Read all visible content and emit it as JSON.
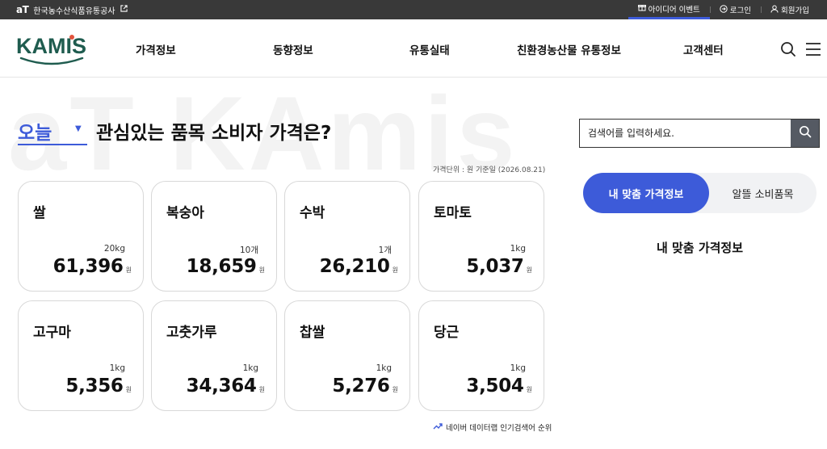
{
  "topbar": {
    "org_logo": "aT",
    "org_name": "한국농수산식품유통공사",
    "links": [
      {
        "label": "아이디어 이벤트",
        "icon": "gift-icon"
      },
      {
        "label": "로그인",
        "icon": "login-icon"
      },
      {
        "label": "회원가입",
        "icon": "user-icon"
      }
    ]
  },
  "header": {
    "logo": "KAMIS",
    "nav": [
      "가격정보",
      "동향정보",
      "유통실태",
      "친환경농산물 유통정보",
      "고객센터"
    ]
  },
  "watermark": "aT KAmis",
  "heading": {
    "day_select": "오늘",
    "title": "관심있는 품목 소비자 가격은?"
  },
  "unit_info": "가격단위 : 원   기준일 (2026.08.21)",
  "products": [
    {
      "name": "쌀",
      "qty": "20kg",
      "price": "61,396",
      "unit": "원"
    },
    {
      "name": "복숭아",
      "qty": "10개",
      "price": "18,659",
      "unit": "원"
    },
    {
      "name": "수박",
      "qty": "1개",
      "price": "26,210",
      "unit": "원"
    },
    {
      "name": "토마토",
      "qty": "1kg",
      "price": "5,037",
      "unit": "원"
    },
    {
      "name": "고구마",
      "qty": "1kg",
      "price": "5,356",
      "unit": "원"
    },
    {
      "name": "고춧가루",
      "qty": "1kg",
      "price": "34,364",
      "unit": "원"
    },
    {
      "name": "찹쌀",
      "qty": "1kg",
      "price": "5,276",
      "unit": "원"
    },
    {
      "name": "당근",
      "qty": "1kg",
      "price": "3,504",
      "unit": "원"
    }
  ],
  "trend_link": "네이버 데이터랩 인기검색어 순위",
  "search": {
    "placeholder": "검색어를 입력하세요."
  },
  "tabs": [
    "내 맞춤 가격정보",
    "알뜰 소비품목"
  ],
  "section_title": "내 맞춤 가격정보",
  "colors": {
    "accent": "#3d5bd9",
    "topbar": "#393939",
    "logo_green": "#1f5c4f",
    "logo_dot": "#e2533c"
  }
}
